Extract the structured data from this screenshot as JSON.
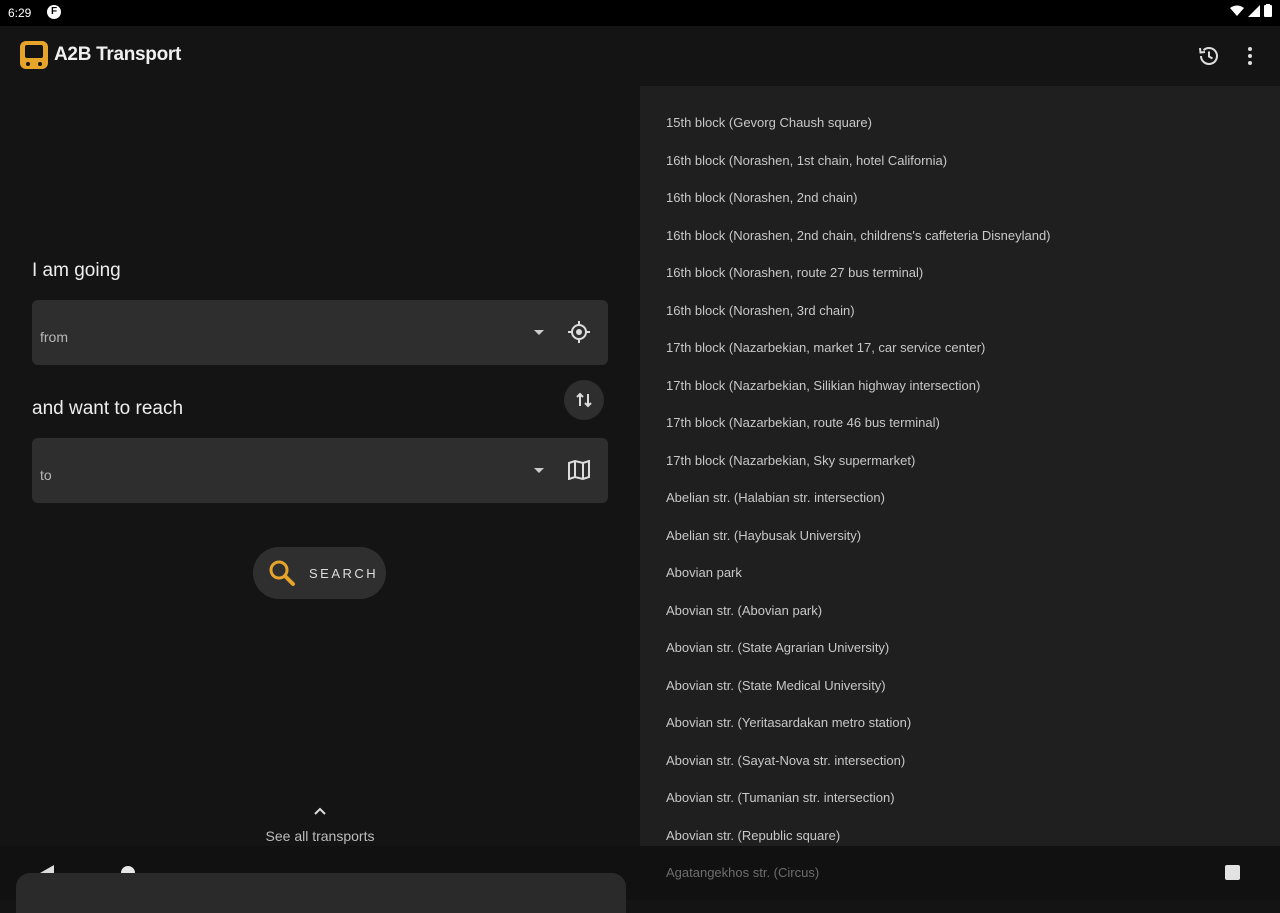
{
  "status_bar": {
    "time": "6:29",
    "app_badge": "F"
  },
  "app_bar": {
    "title": "A2B Transport"
  },
  "form": {
    "from_heading": "I am going",
    "from_placeholder": "from",
    "to_heading": "and want to reach",
    "to_placeholder": "to",
    "search_label": "SEARCH"
  },
  "see_all_label": "See all transports",
  "stops": [
    "15th block (Gevorg Chaush square)",
    "16th block (Norashen, 1st chain, hotel California)",
    "16th block (Norashen, 2nd chain)",
    "16th block (Norashen, 2nd chain, childrens's caffeteria Disneyland)",
    "16th block (Norashen, route 27 bus terminal)",
    "16th block (Norashen, 3rd chain)",
    "17th block (Nazarbekian, market 17, car service center)",
    "17th block (Nazarbekian,   Silikian highway intersection)",
    "17th block (Nazarbekian, route 46 bus terminal)",
    "17th block (Nazarbekian, Sky supermarket)",
    "Abelian str. (Halabian str. intersection)",
    "Abelian str. (Haybusak University)",
    "Abovian park",
    "Abovian str. (Abovian park)",
    "Abovian str. (State Agrarian University)",
    "Abovian str. (State Medical University)",
    "Abovian str. (Yeritasardakan metro station)",
    "Abovian str. (Sayat-Nova str. intersection)",
    "Abovian str. (Tumanian str. intersection)",
    "Abovian str. (Republic square)"
  ],
  "last_stop_partial": "Agatangekhos str. (Circus)",
  "colors": {
    "accent": "#e6a42b",
    "background": "#141414",
    "list_background": "#1f1f1f",
    "field": "#2e2e2e"
  },
  "icons": [
    "history-icon",
    "more-vert-icon",
    "dropdown-icon",
    "my-location-icon",
    "swap-icon",
    "map-icon",
    "search-icon",
    "chevron-up-icon"
  ]
}
